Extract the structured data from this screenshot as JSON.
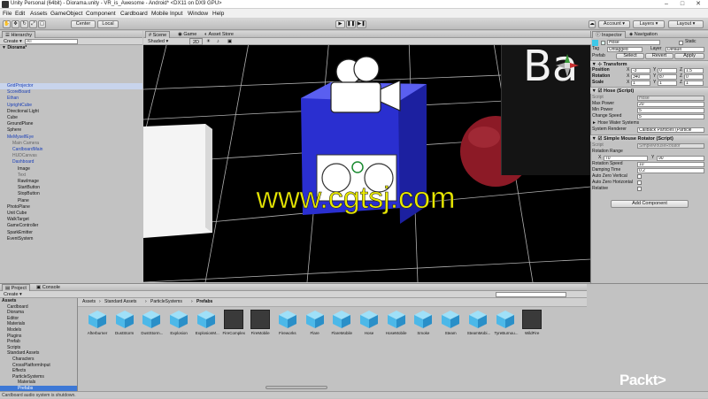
{
  "window": {
    "title": "Unity Personal (64bit) - Diorama.unity - VR_is_Awesome - Android* <DX11 on DX9 GPU>"
  },
  "menu": [
    "File",
    "Edit",
    "Assets",
    "GameObject",
    "Component",
    "Cardboard",
    "Mobile Input",
    "Window",
    "Help"
  ],
  "toolbar": {
    "center": "Center",
    "local": "Local",
    "account": "Account",
    "layers": "Layers",
    "layout": "Layout"
  },
  "hierarchy": {
    "tab": "Hierarchy",
    "create": "Create",
    "search_placeholder": "All",
    "scene": "Diorama*",
    "items": [
      {
        "label": "GridProjector",
        "indent": 1,
        "style": "sel-blue"
      },
      {
        "label": "ScoreBoard",
        "indent": 1,
        "style": "blue"
      },
      {
        "label": "Ethan",
        "indent": 1,
        "style": "blue"
      },
      {
        "label": "UprightCube",
        "indent": 1,
        "style": "blue"
      },
      {
        "label": "Directional Light",
        "indent": 1,
        "style": ""
      },
      {
        "label": "Cube",
        "indent": 1,
        "style": ""
      },
      {
        "label": "GroundPlane",
        "indent": 1,
        "style": ""
      },
      {
        "label": "Sphere",
        "indent": 1,
        "style": ""
      },
      {
        "label": "MeMyselfEye",
        "indent": 1,
        "style": "blue"
      },
      {
        "label": "Main Camera",
        "indent": 2,
        "style": "gray"
      },
      {
        "label": "CardboardMain",
        "indent": 2,
        "style": "blue"
      },
      {
        "label": "HUDCanvas",
        "indent": 2,
        "style": "gray"
      },
      {
        "label": "Dashboard",
        "indent": 2,
        "style": "blue"
      },
      {
        "label": "Image",
        "indent": 3,
        "style": ""
      },
      {
        "label": "Text",
        "indent": 3,
        "style": "gray"
      },
      {
        "label": "RawImage",
        "indent": 3,
        "style": ""
      },
      {
        "label": "StartButton",
        "indent": 3,
        "style": ""
      },
      {
        "label": "StopButton",
        "indent": 3,
        "style": ""
      },
      {
        "label": "Plane",
        "indent": 3,
        "style": ""
      },
      {
        "label": "PhotoPlane",
        "indent": 1,
        "style": ""
      },
      {
        "label": "Unit Cube",
        "indent": 1,
        "style": ""
      },
      {
        "label": "WalkTarget",
        "indent": 1,
        "style": ""
      },
      {
        "label": "GameController",
        "indent": 1,
        "style": ""
      },
      {
        "label": "SparkEmitter",
        "indent": 1,
        "style": ""
      },
      {
        "label": "EventSystem",
        "indent": 1,
        "style": ""
      }
    ]
  },
  "scene_view": {
    "tabs": [
      "Scene",
      "Game",
      "Asset Store"
    ],
    "shaded": "Shaded",
    "mode_2d": "2D",
    "gizmos": "Gizmos",
    "search_placeholder": "All",
    "watermark": "www.cgtsj.com",
    "camera_overlay_text": "Ba"
  },
  "inspector": {
    "tabs": [
      "Inspector",
      "Navigation"
    ],
    "object_name": "Hose",
    "static_label": "Static",
    "tag_label": "Tag",
    "tag_value": "Untagged",
    "layer_label": "Layer",
    "layer_value": "Default",
    "prefab_label": "Prefab",
    "prefab_buttons": [
      "Select",
      "Revert",
      "Apply"
    ],
    "transform": {
      "title": "Transform",
      "rows": [
        {
          "label": "Position",
          "x": "-3",
          "y": "0",
          "z": "1.5"
        },
        {
          "label": "Rotation",
          "x": "340",
          "y": "87",
          "z": "0"
        },
        {
          "label": "Scale",
          "x": "1",
          "y": "1",
          "z": "1"
        }
      ]
    },
    "hose_script": {
      "title": "Hose (Script)",
      "script_label": "Script",
      "script_value": "Hose",
      "fields": [
        {
          "label": "Max Power",
          "value": "20"
        },
        {
          "label": "Min Power",
          "value": "5"
        },
        {
          "label": "Change Speed",
          "value": "5"
        }
      ],
      "water_systems_label": "Hose Water Systems",
      "renderer_label": "System Renderer",
      "renderer_value": "Callback Particles (Particle"
    },
    "rotator_script": {
      "title": "Simple Mouse Rotator (Script)",
      "script_label": "Script",
      "script_value": "SimpleMouseRotator",
      "rotation_range_label": "Rotation Range",
      "range_x": "70",
      "range_y": "90",
      "fields": [
        {
          "label": "Rotation Speed",
          "value": "10"
        },
        {
          "label": "Damping Time",
          "value": "0.2"
        }
      ],
      "checks": [
        {
          "label": "Auto Zero Vertical",
          "checked": false
        },
        {
          "label": "Auto Zero Horizontal",
          "checked": false
        },
        {
          "label": "Relative",
          "checked": false
        }
      ]
    },
    "add_component": "Add Component"
  },
  "project": {
    "tabs": [
      "Project",
      "Console"
    ],
    "create": "Create",
    "tree": [
      {
        "label": "Assets",
        "indent": 0,
        "bold": true
      },
      {
        "label": "Cardboard",
        "indent": 1
      },
      {
        "label": "Diorama",
        "indent": 1
      },
      {
        "label": "Editor",
        "indent": 1
      },
      {
        "label": "Materials",
        "indent": 1
      },
      {
        "label": "Models",
        "indent": 1
      },
      {
        "label": "Plugins",
        "indent": 1
      },
      {
        "label": "Prefab",
        "indent": 1
      },
      {
        "label": "Scripts",
        "indent": 1
      },
      {
        "label": "Standard Assets",
        "indent": 1
      },
      {
        "label": "Characters",
        "indent": 2
      },
      {
        "label": "CrossPlatformInput",
        "indent": 2
      },
      {
        "label": "Effects",
        "indent": 2
      },
      {
        "label": "ParticleSystems",
        "indent": 2
      },
      {
        "label": "Materials",
        "indent": 3
      },
      {
        "label": "Prefabs",
        "indent": 3,
        "selected": true
      }
    ],
    "breadcrumb": [
      "Assets",
      "Standard Assets",
      "ParticleSystems",
      "Prefabs"
    ],
    "assets": [
      {
        "label": "Afterburner",
        "kind": "cube"
      },
      {
        "label": "DustStorm",
        "kind": "cube"
      },
      {
        "label": "DustStorm...",
        "kind": "cube"
      },
      {
        "label": "Explosion",
        "kind": "cube"
      },
      {
        "label": "ExplosionM...",
        "kind": "cube"
      },
      {
        "label": "FireComplex",
        "kind": "dark"
      },
      {
        "label": "FireMobile",
        "kind": "dark"
      },
      {
        "label": "Fireworks",
        "kind": "cube"
      },
      {
        "label": "Flare",
        "kind": "cube"
      },
      {
        "label": "FlareMobile",
        "kind": "cube"
      },
      {
        "label": "Hose",
        "kind": "cube"
      },
      {
        "label": "HoseMobile",
        "kind": "cube"
      },
      {
        "label": "Smoke",
        "kind": "cube"
      },
      {
        "label": "Steam",
        "kind": "cube"
      },
      {
        "label": "SteamMobi...",
        "kind": "cube"
      },
      {
        "label": "TyreBurnou...",
        "kind": "cube"
      },
      {
        "label": "WildFire",
        "kind": "dark"
      }
    ]
  },
  "status": {
    "text": "Cardboard audio system is shutdown."
  },
  "brand": {
    "label": "Packt>"
  },
  "colors": {
    "selection": "#3d78d6",
    "scene_bg": "#000000",
    "cube_blue": "#2a2fd0",
    "sphere_red": "#8c1a26",
    "watermark": "#e8e800"
  }
}
